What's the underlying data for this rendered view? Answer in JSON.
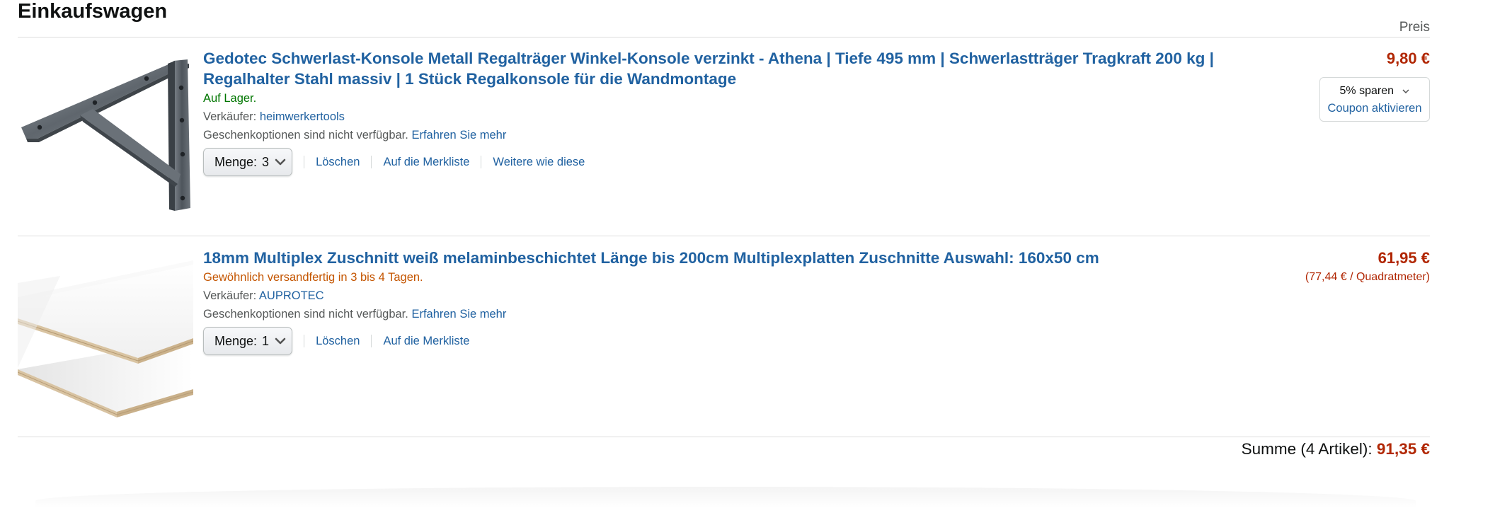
{
  "cart": {
    "title": "Einkaufswagen",
    "price_header": "Preis",
    "subtotal_label": "Summe (4 Artikel):",
    "subtotal_amount": "91,35 €"
  },
  "items": [
    {
      "title": "Gedotec Schwerlast-Konsole Metall Regalträger Winkel-Konsole verzinkt - Athena | Tiefe 495 mm | Schwerlastträger Tragkraft 200 kg | Regalhalter Stahl massiv | 1 Stück Regalkonsole für die Wandmontage",
      "availability": "Auf Lager.",
      "seller_label": "Verkäufer:",
      "seller": "heimwerkertools",
      "gift_text": "Geschenkoptionen sind nicht verfügbar.",
      "gift_link": "Erfahren Sie mehr",
      "qty_label": "Menge:",
      "qty_value": "3",
      "delete_label": "Löschen",
      "save_label": "Auf die Merkliste",
      "similar_label": "Weitere wie diese",
      "price": "9,80 €",
      "coupon_save": "5% sparen",
      "coupon_activate": "Coupon aktivieren",
      "image_icon": "shelf-bracket-image"
    },
    {
      "title": "18mm Multiplex Zuschnitt weiß melaminbeschichtet Länge bis 200cm Multiplexplatten Zuschnitte Auswahl: 160x50 cm",
      "availability": "Gewöhnlich versandfertig in 3 bis 4 Tagen.",
      "seller_label": "Verkäufer:",
      "seller": "AUPROTEC",
      "gift_text": "Geschenkoptionen sind nicht verfügbar.",
      "gift_link": "Erfahren Sie mehr",
      "qty_label": "Menge:",
      "qty_value": "1",
      "delete_label": "Löschen",
      "save_label": "Auf die Merkliste",
      "price": "61,95 €",
      "unit_price": "(77,44 € / Quadratmeter)",
      "image_icon": "plywood-panel-image"
    }
  ],
  "colors": {
    "link": "#2162a1",
    "price": "#b12704",
    "in_stock": "#007600",
    "shipping_notice": "#c45500"
  }
}
